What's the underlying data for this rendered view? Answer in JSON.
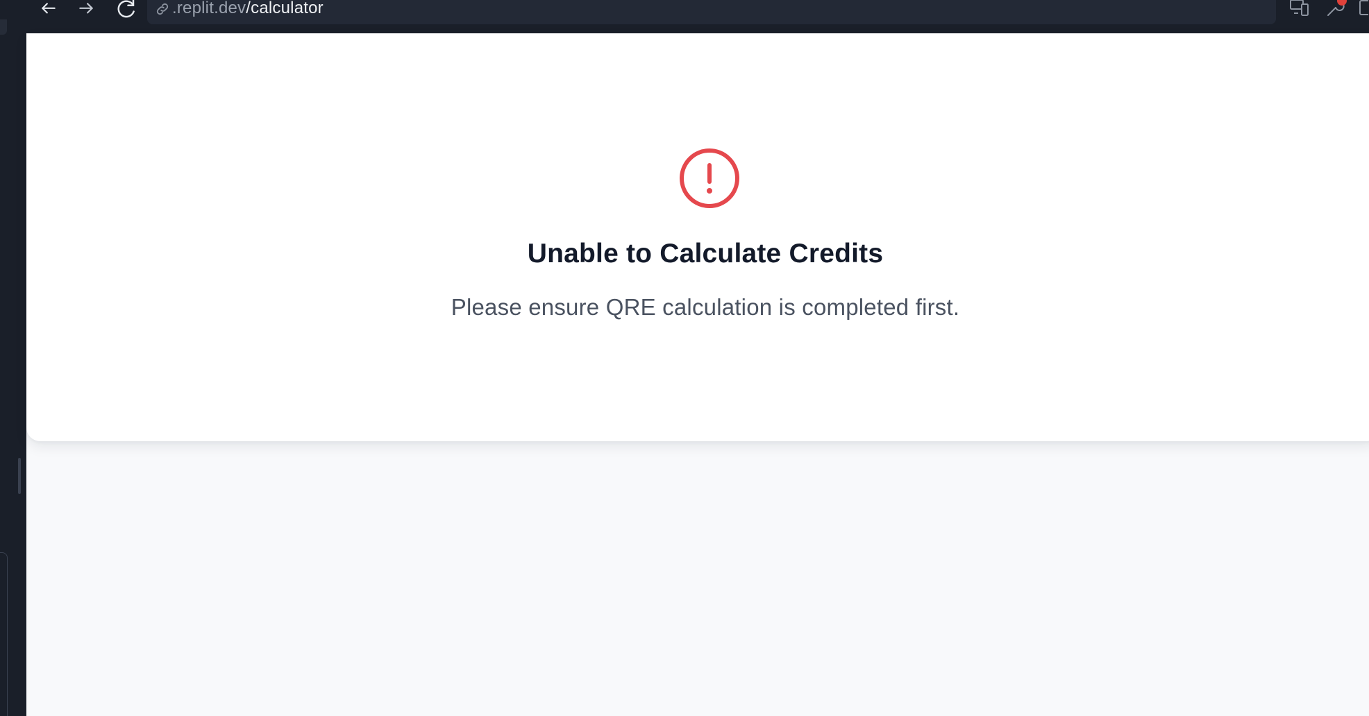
{
  "browser": {
    "url_host": ".replit.dev",
    "url_path": "/calculator",
    "icons": {
      "back": "arrow-left-icon",
      "forward": "arrow-right-icon",
      "reload": "reload-icon",
      "link": "link-icon",
      "devices": "devices-icon",
      "tools": "wrench-icon"
    },
    "badge_color": "#e0413a"
  },
  "error": {
    "icon": "alert-circle-icon",
    "icon_color": "#e5484d",
    "title": "Unable to Calculate Credits",
    "message": "Please ensure QRE calculation is completed first."
  }
}
